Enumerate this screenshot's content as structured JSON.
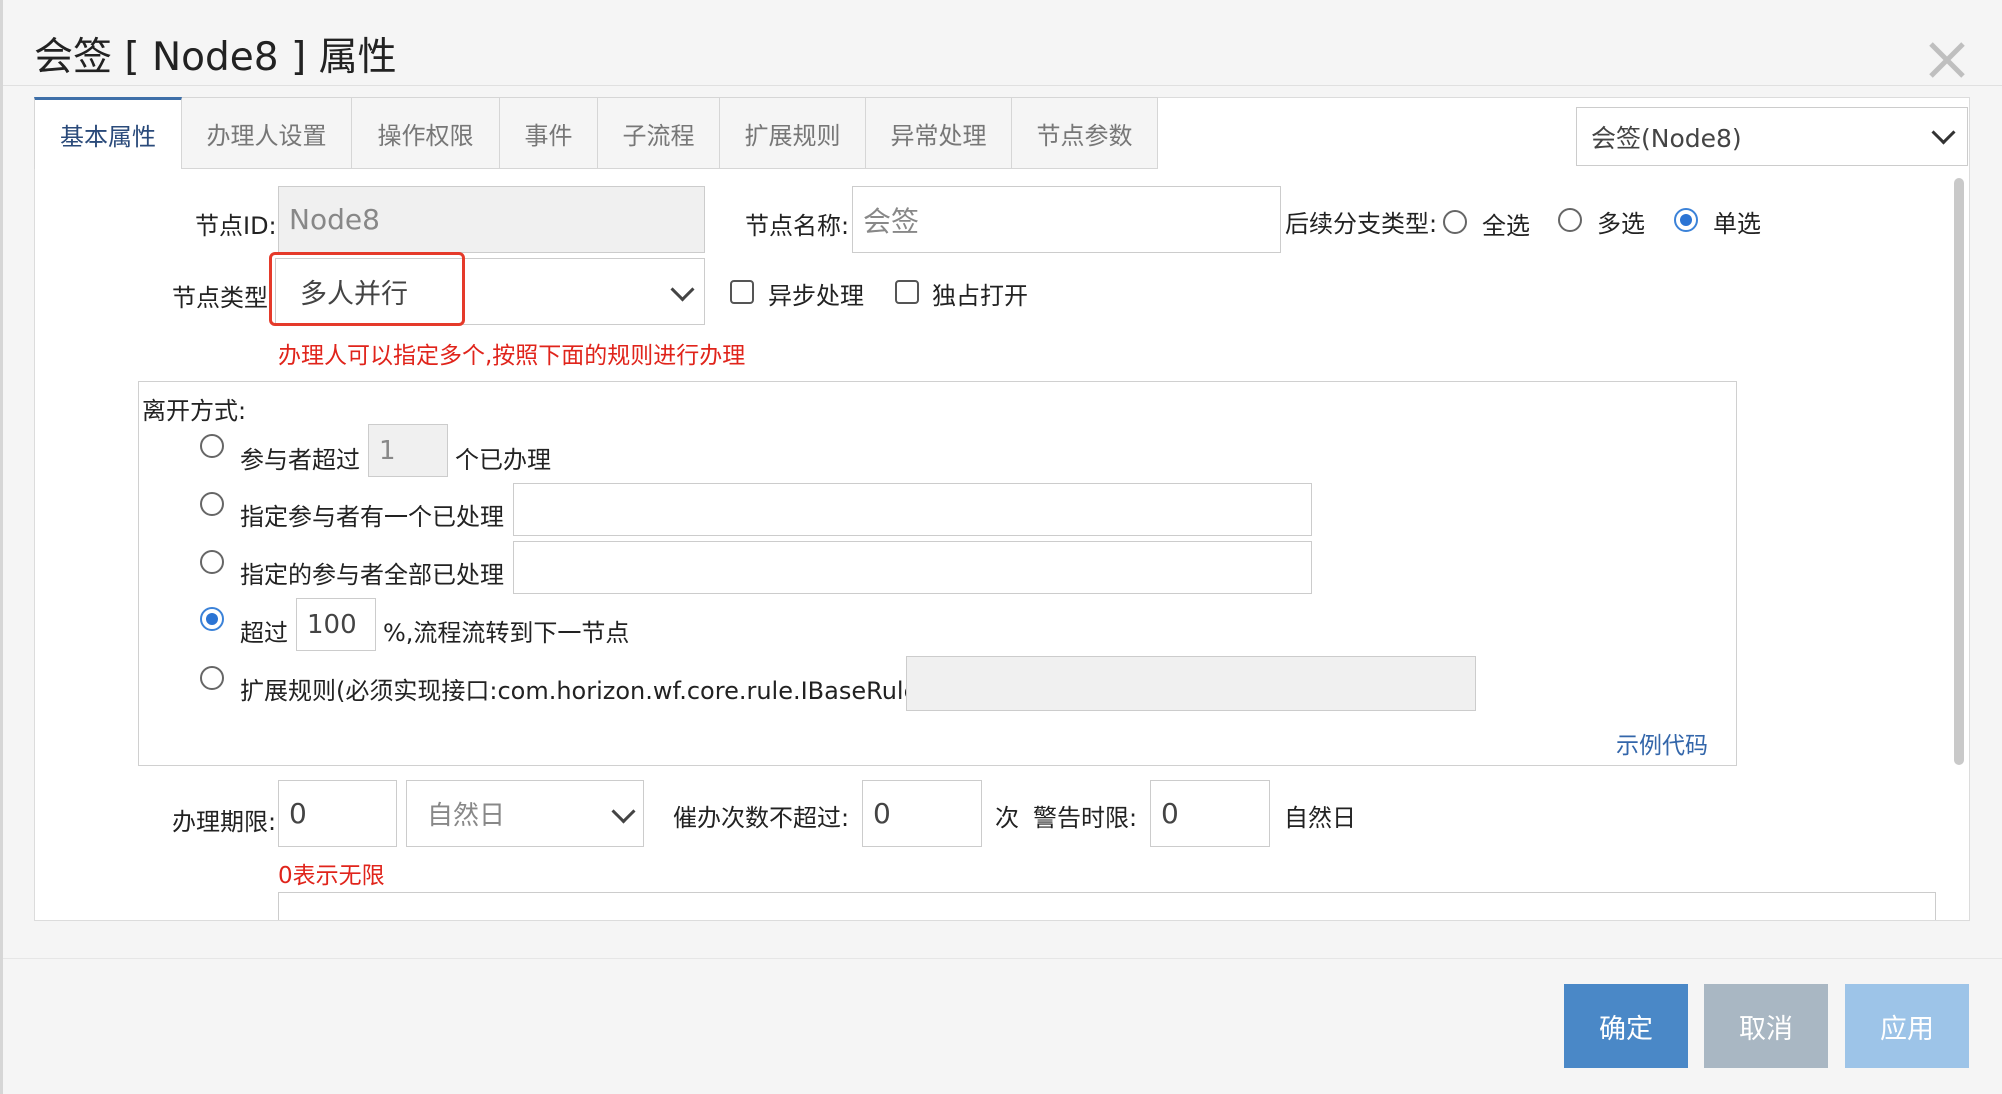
{
  "dialog": {
    "title": "会签 [ Node8 ] 属性"
  },
  "tabs": [
    {
      "label": "基本属性"
    },
    {
      "label": "办理人设置"
    },
    {
      "label": "操作权限"
    },
    {
      "label": "事件"
    },
    {
      "label": "子流程"
    },
    {
      "label": "扩展规则"
    },
    {
      "label": "异常处理"
    },
    {
      "label": "节点参数"
    }
  ],
  "node_select": {
    "value": "会签(Node8)"
  },
  "form": {
    "node_id_label": "节点ID:",
    "node_id_value": "Node8",
    "node_name_label": "节点名称:",
    "node_name_value": "会签",
    "branch_label": "后续分支类型:",
    "branch_options": [
      "全选",
      "多选",
      "单选"
    ],
    "branch_selected": "单选",
    "node_type_label": "节点类型",
    "node_type_value": "多人并行",
    "async_label": "异步处理",
    "exclusive_label": "独占打开",
    "node_type_hint": "办理人可以指定多个,按照下面的规则进行办理",
    "leave": {
      "legend": "离开方式:",
      "opt1_prefix": "参与者超过",
      "opt1_value": "1",
      "opt1_suffix": "个已办理",
      "opt2_label": "指定参与者有一个已处理",
      "opt3_label": "指定的参与者全部已处理",
      "opt4_prefix": "超过",
      "opt4_value": "100",
      "opt4_suffix": "%,流程流转到下一节点",
      "opt5_label": "扩展规则(必须实现接口:com.horizon.wf.core.rule.IBaseRule)",
      "selected": 4,
      "sample_link": "示例代码"
    },
    "deadline_label": "办理期限:",
    "deadline_value": "0",
    "deadline_unit": "自然日",
    "deadline_hint": "0表示无限",
    "urge_label": "催办次数不超过:",
    "urge_value": "0",
    "urge_suffix": "次",
    "warn_label": "警告时限:",
    "warn_value": "0",
    "warn_suffix": "自然日"
  },
  "buttons": {
    "ok": "确定",
    "cancel": "取消",
    "apply": "应用"
  },
  "colors": {
    "primary": "#4a88c7",
    "disabled": "#a9b7c3",
    "apply": "#9dc4e8",
    "error": "#e0241b"
  }
}
